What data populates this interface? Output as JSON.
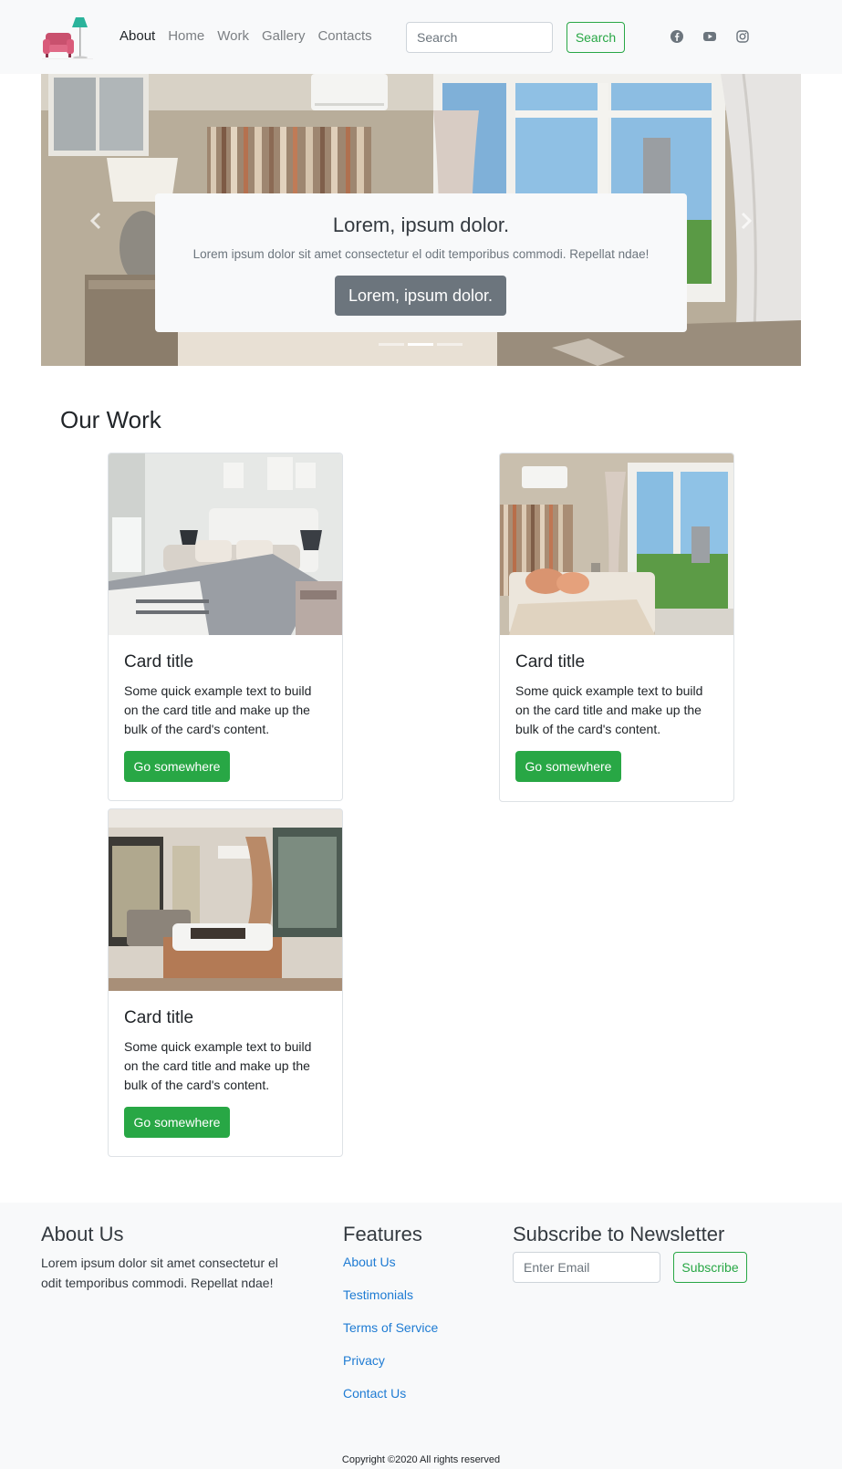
{
  "navbar": {
    "logo_icon": "armchair-lamp-logo",
    "links": [
      {
        "label": "About",
        "active": true
      },
      {
        "label": "Home",
        "active": false
      },
      {
        "label": "Work",
        "active": false
      },
      {
        "label": "Gallery",
        "active": false
      },
      {
        "label": "Contacts",
        "active": false
      }
    ],
    "search_placeholder": "Search",
    "search_button": "Search",
    "social_icons": [
      "facebook-icon",
      "youtube-icon",
      "instagram-icon"
    ]
  },
  "carousel": {
    "caption_title": "Lorem, ipsum dolor.",
    "caption_text": "Lorem ipsum dolor sit amet consectetur el odit temporibus commodi. Repellat ndae!",
    "caption_button": "Lorem, ipsum dolor.",
    "indicator_count": 3,
    "active_indicator": 2
  },
  "work": {
    "title": "Our Work",
    "cards": [
      {
        "title": "Card title",
        "text": "Some quick example text to build on the card title and make up the bulk of the card's content.",
        "button": "Go somewhere"
      },
      {
        "title": "Card title",
        "text": "Some quick example text to build on the card title and make up the bulk of the card's content.",
        "button": "Go somewhere"
      },
      {
        "title": "Card title",
        "text": "Some quick example text to build on the card title and make up the bulk of the card's content.",
        "button": "Go somewhere"
      }
    ]
  },
  "footer": {
    "about_title": "About Us",
    "about_text": "Lorem ipsum dolor sit amet consectetur el odit temporibus commodi. Repellat ndae!",
    "features_title": "Features",
    "features_links": [
      "About Us",
      "Testimonials",
      "Terms of Service",
      "Privacy",
      "Contact Us"
    ],
    "newsletter_title": "Subscribe to Newsletter",
    "email_placeholder": "Enter Email",
    "subscribe_button": "Subscribe",
    "copyright": "Copyright ©2020 All rights reserved"
  },
  "colors": {
    "accent_green": "#28a745",
    "link_blue": "#1e7bd3",
    "nav_bg": "#f8f9fa",
    "caption_button_gray": "#6c757d"
  }
}
